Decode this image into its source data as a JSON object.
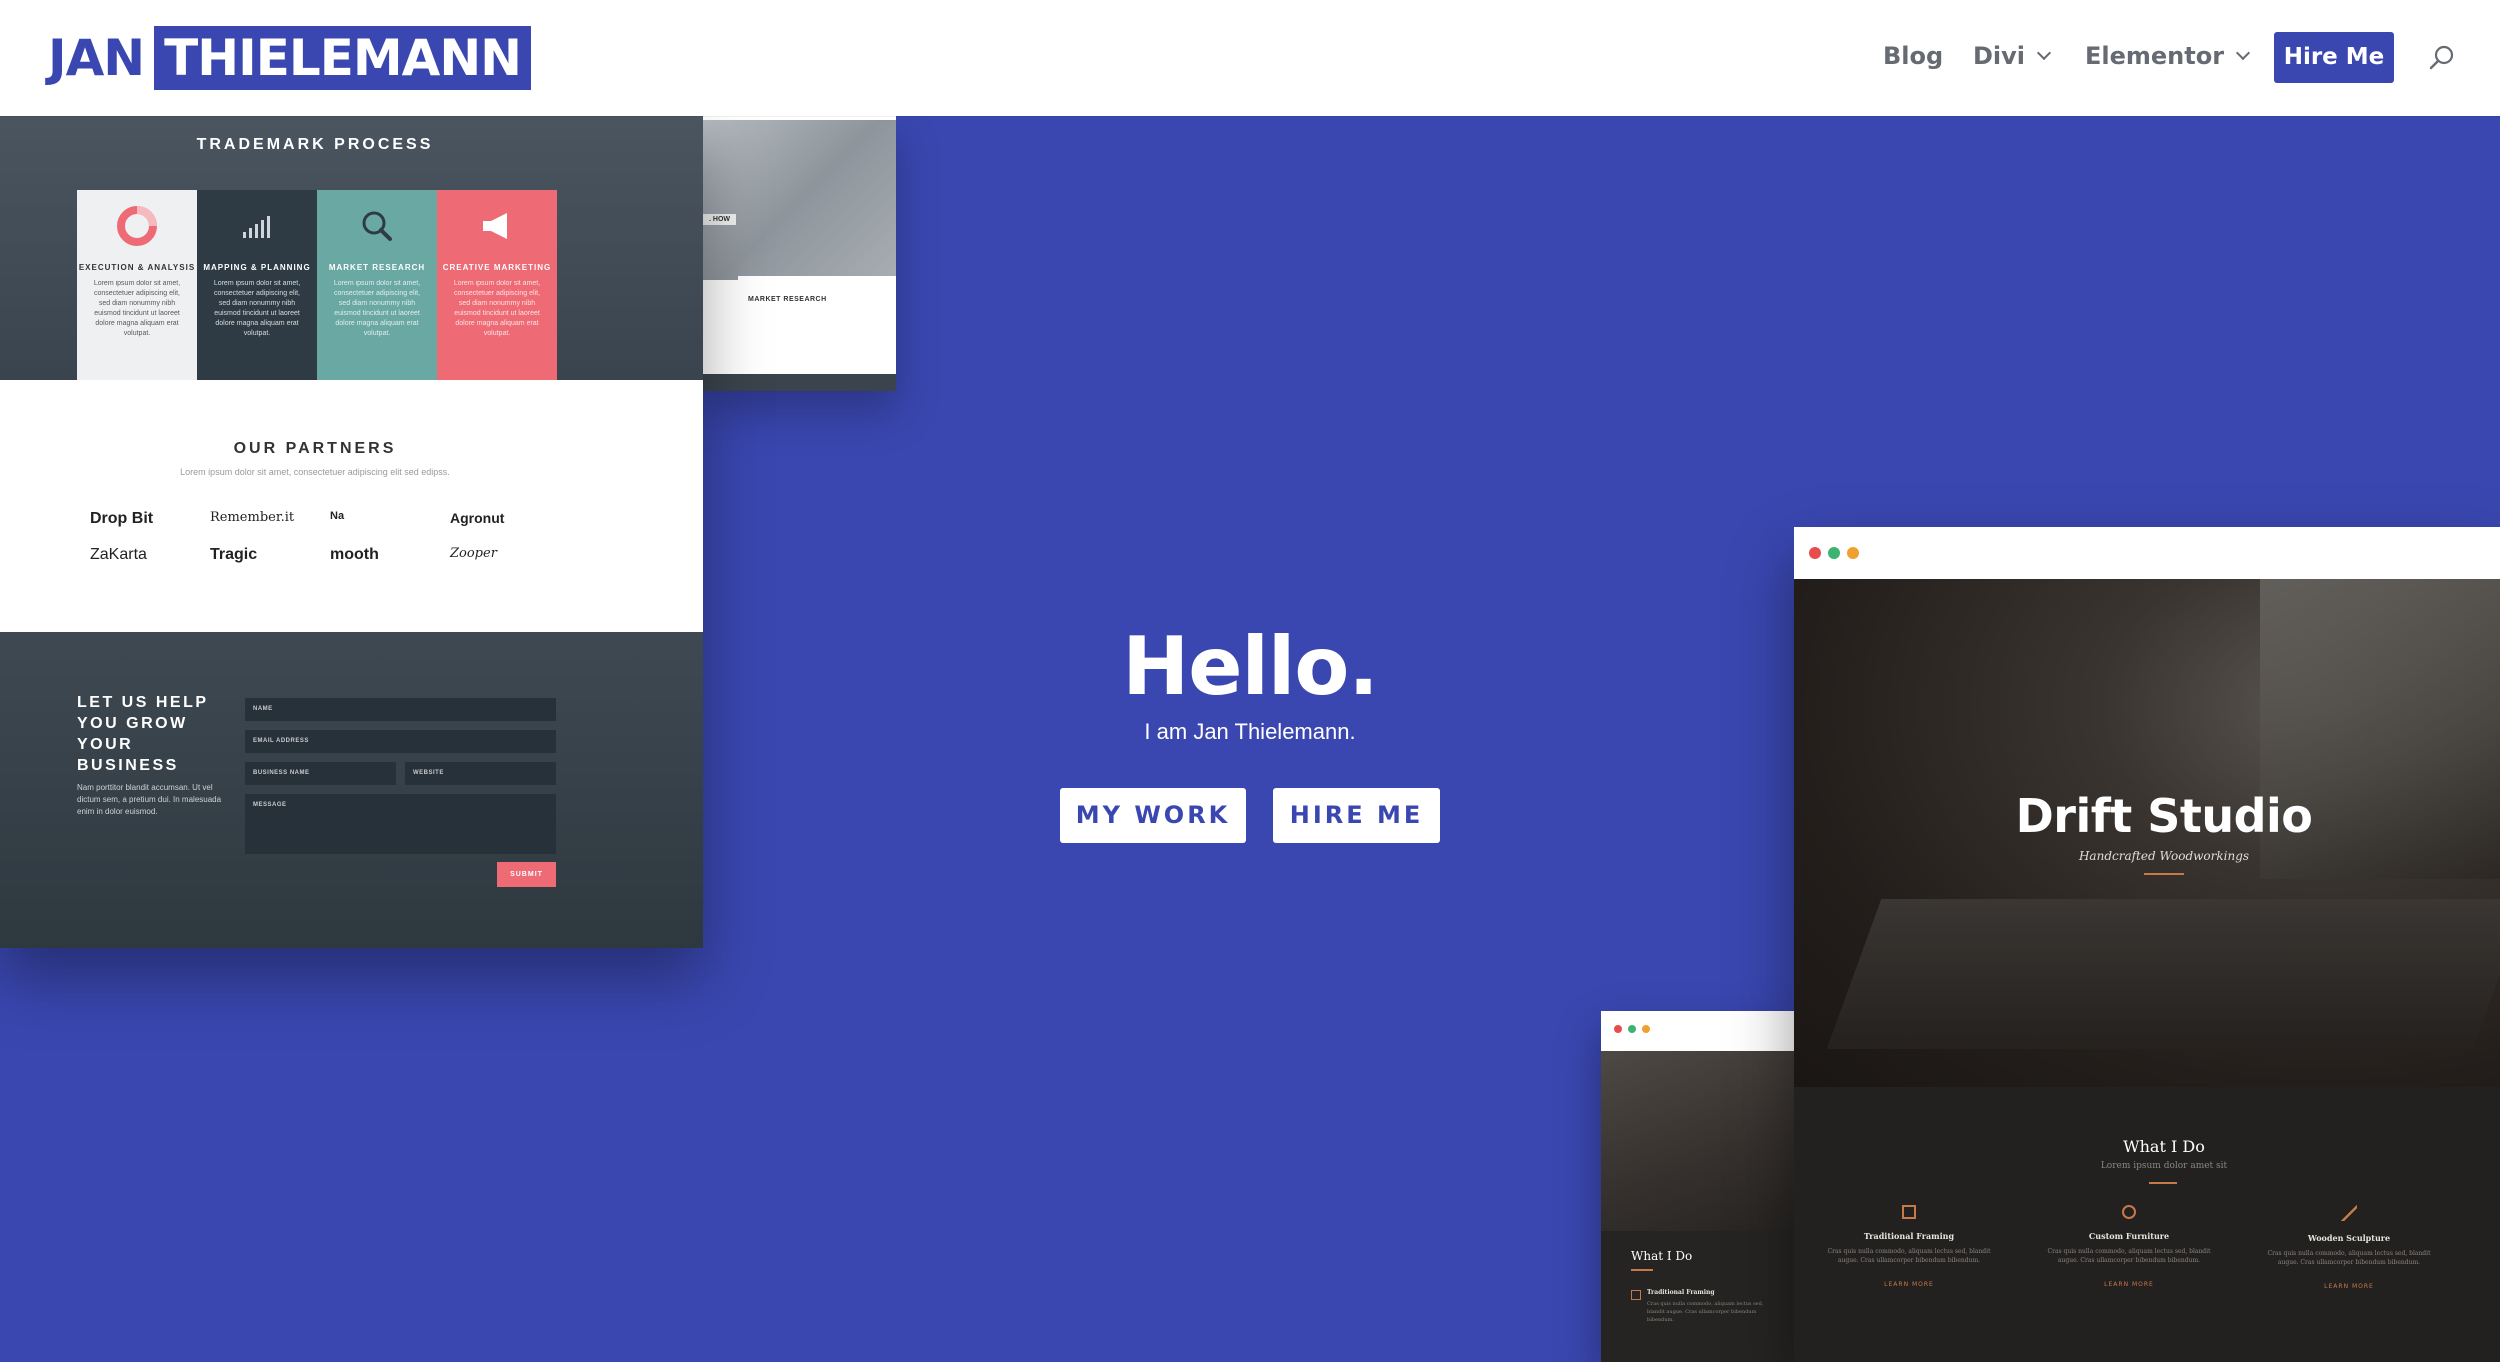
{
  "header": {
    "logo_first": "JAN",
    "logo_last": "THIELEMANN",
    "nav": {
      "blog": "Blog",
      "divi": "Divi",
      "elementor": "Elementor",
      "hire_me": "Hire Me"
    }
  },
  "hero": {
    "title": "Hello.",
    "subtitle": "I am Jan Thielemann.",
    "buttons": {
      "work": "MY WORK",
      "hire": "HIRE ME"
    }
  },
  "mock_left": {
    "trademark_title": "TRADEMARK PROCESS",
    "cards": [
      {
        "title": "EXECUTION & ANALYSIS",
        "text": "Lorem ipsum dolor sit amet, consectetuer adipiscing elit, sed diam nonummy nibh euismod tincidunt ut laoreet dolore magna aliquam erat volutpat.",
        "color": "#eef0f2"
      },
      {
        "title": "MAPPING & PLANNING",
        "text": "Lorem ipsum dolor sit amet, consectetuer adipiscing elit, sed diam nonummy nibh euismod tincidunt ut laoreet dolore magna aliquam erat volutpat.",
        "color": "#2f3b44"
      },
      {
        "title": "MARKET RESEARCH",
        "text": "Lorem ipsum dolor sit amet, consectetuer adipiscing elit, sed diam nonummy nibh euismod tincidunt ut laoreet dolore magna aliquam erat volutpat.",
        "color": "#6aa8a3"
      },
      {
        "title": "CREATIVE MARKETING",
        "text": "Lorem ipsum dolor sit amet, consectetuer adipiscing elit, sed diam nonummy nibh euismod tincidunt ut laoreet dolore magna aliquam erat volutpat.",
        "color": "#ee6b76"
      }
    ],
    "partners_title": "OUR PARTNERS",
    "partners_sub": "Lorem ipsum dolor sit amet, consectetuer adipiscing elit sed edipss.",
    "partners": [
      "Drop Bit",
      "Remember.it",
      "Na",
      "Agronut",
      "ZaKarta",
      "Tragic",
      "mooth",
      "Zooper"
    ],
    "contact_title": "LET US HELP YOU GROW YOUR BUSINESS",
    "contact_text": "Nam porttitor blandit accumsan. Ut vel dictum sem, a pretium dui. In malesuada enim in dolor euismod.",
    "fields": {
      "name": "NAME",
      "email": "EMAIL ADDRESS",
      "business": "BUSINESS NAME",
      "website": "WEBSITE",
      "message": "MESSAGE"
    },
    "submit": "SUBMIT"
  },
  "mock_top": {
    "how": ". HOW",
    "card_title": "MARKET RESEARCH"
  },
  "mock_right": {
    "title": "Drift Studio",
    "subtitle": "Handcrafted Woodworkings",
    "what_title": "What I Do",
    "what_sub": "Lorem ipsum dolor amet sit",
    "columns": [
      {
        "title": "Traditional Framing",
        "text": "Cras quis nulla commodo, aliquam lectus sed, blandit augue. Cras ullamcorper bibendum bibendum.",
        "link": "LEARN MORE"
      },
      {
        "title": "Custom Furniture",
        "text": "Cras quis nulla commodo, aliquam lectus sed, blandit augue. Cras ullamcorper bibendum bibendum.",
        "link": "LEARN MORE"
      },
      {
        "title": "Wooden Sculpture",
        "text": "Cras quis nulla commodo, aliquam lectus sed, blandit augue. Cras ullamcorper bibendum bibendum.",
        "link": "LEARN MORE"
      }
    ]
  },
  "mock_small": {
    "what_title": "What I Do",
    "item_title": "Traditional Framing",
    "item_text": "Cras quis nulla commodo, aliquam lectus sed, blandit augue. Cras ullamcorper bibendum bibendum."
  },
  "colors": {
    "brand": "#3a47b0",
    "background": "#3a47b0",
    "white": "#ffffff",
    "accent_red": "#ee6b76",
    "accent_teal": "#6aa8a3",
    "wood_accent": "#c8794a"
  },
  "icons": [
    "search-icon",
    "chevron-down-icon",
    "donut-chart-icon",
    "bar-chart-icon",
    "magnifier-icon",
    "megaphone-icon"
  ]
}
